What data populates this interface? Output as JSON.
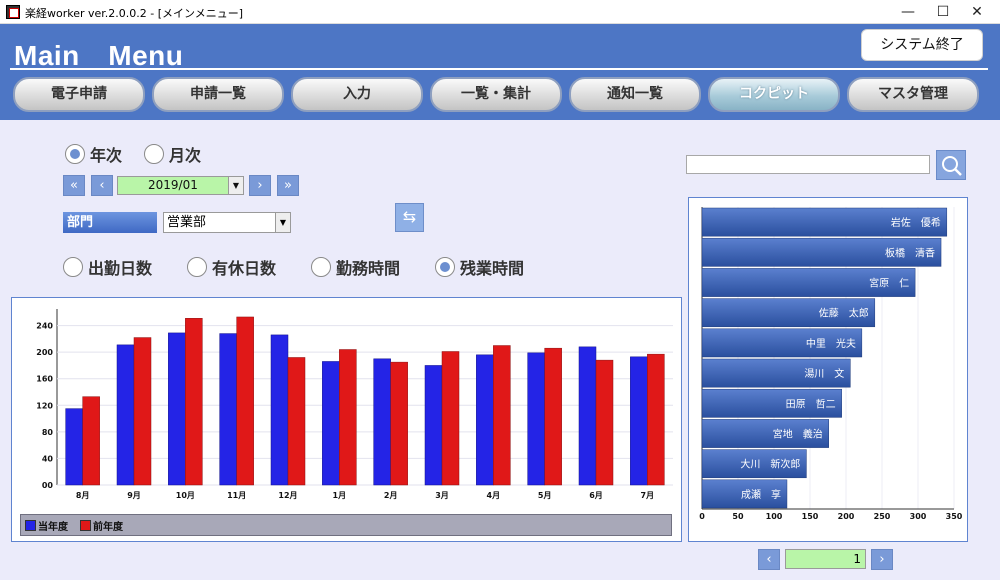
{
  "window": {
    "title": "楽経worker ver.2.0.0.2 - [メインメニュー]",
    "minimize": "—",
    "maximize": "☐",
    "close": "✕"
  },
  "header": {
    "title": "Main　Menu",
    "exit_label": "システム終了"
  },
  "tabs": [
    {
      "label": "電子申請"
    },
    {
      "label": "申請一覧"
    },
    {
      "label": "入力"
    },
    {
      "label": "一覧・集計"
    },
    {
      "label": "通知一覧"
    },
    {
      "label": "コクピット",
      "active": true
    },
    {
      "label": "マスタ管理"
    }
  ],
  "period": {
    "yearly": "年次",
    "monthly": "月次",
    "selected": "yearly",
    "date": "2019/01"
  },
  "nav_icons": {
    "first": "«",
    "prev": "‹",
    "next": "›",
    "last": "»"
  },
  "department": {
    "label": "部門",
    "value": "営業部"
  },
  "metrics": {
    "options": [
      "出勤日数",
      "有休日数",
      "勤務時間",
      "残業時間"
    ],
    "selected": 3
  },
  "colors": {
    "current": "#2424e6",
    "previous": "#e01818",
    "bar_h": "#2a4f9e",
    "accent": "#4d76c5"
  },
  "chart_data": [
    {
      "type": "bar",
      "categories": [
        "8月",
        "9月",
        "10月",
        "11月",
        "12月",
        "1月",
        "2月",
        "3月",
        "4月",
        "5月",
        "6月",
        "7月"
      ],
      "series": [
        {
          "name": "当年度",
          "values": [
            115,
            211,
            229,
            228,
            226,
            186,
            190,
            180,
            196,
            199,
            208,
            193
          ]
        },
        {
          "name": "前年度",
          "values": [
            133,
            222,
            251,
            253,
            192,
            204,
            185,
            201,
            210,
            206,
            188,
            197
          ]
        }
      ],
      "yticks": [
        "00",
        "40",
        "80",
        "120",
        "160",
        "200",
        "240"
      ],
      "ylim": [
        0,
        265
      ],
      "legend": "bottom"
    },
    {
      "type": "bar",
      "orientation": "horizontal",
      "categories": [
        "岩佐　優希",
        "板橋　清香",
        "宮原　仁",
        "佐藤　太郎",
        "中里　光夫",
        "湯川　文",
        "田原　哲二",
        "宮地　義治",
        "大川　新次郎",
        "成瀬　享"
      ],
      "values": [
        340,
        332,
        296,
        240,
        222,
        206,
        194,
        176,
        145,
        118
      ],
      "xticks": [
        "0",
        "50",
        "100",
        "150",
        "200",
        "250",
        "300",
        "350"
      ],
      "xlim": [
        0,
        350
      ]
    }
  ],
  "ranking": {
    "search_placeholder": "",
    "page": "1"
  }
}
